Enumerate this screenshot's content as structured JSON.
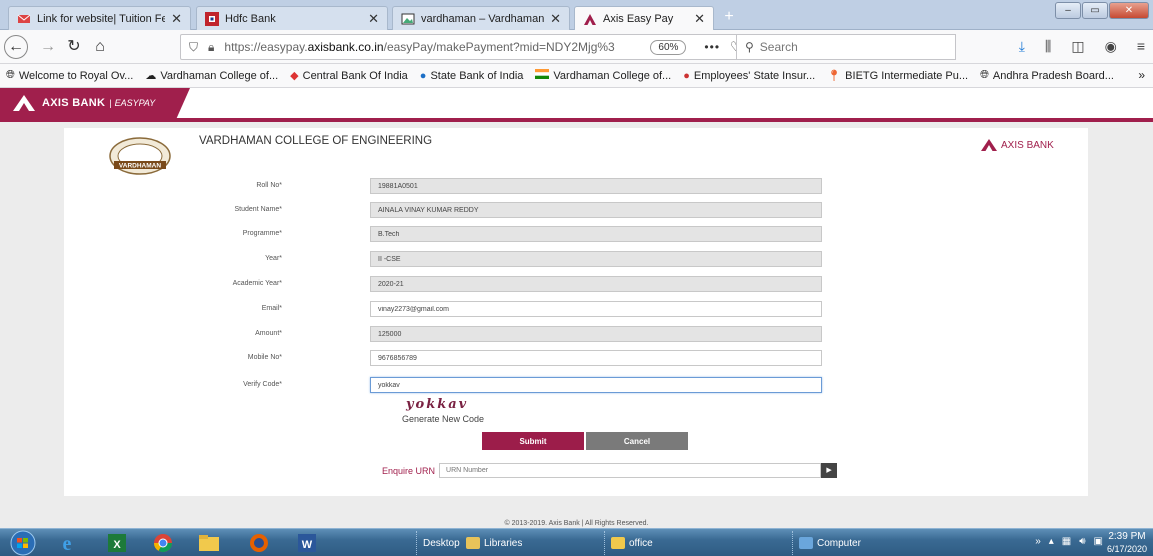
{
  "browser": {
    "tabs": [
      {
        "label": "Link for website| Tuition Fee - V",
        "icon": "mail-icon",
        "active": false
      },
      {
        "label": "Hdfc Bank",
        "icon": "hdfc-icon",
        "active": false
      },
      {
        "label": "vardhaman – Vardhaman Colle",
        "icon": "picture-icon",
        "active": false
      },
      {
        "label": "Axis Easy Pay",
        "icon": "axis-icon",
        "active": true
      }
    ],
    "url": {
      "prefix": "https://easypay.",
      "domain": "axisbank.co.in",
      "path": "/easyPay/makePayment?mid=NDY2Mjg%3"
    },
    "zoom": "60%",
    "search_placeholder": "Search",
    "bookmarks": [
      {
        "label": "Welcome to Royal Ov...",
        "icon": "globe-icon"
      },
      {
        "label": "Vardhaman College of...",
        "icon": "cloud-icon"
      },
      {
        "label": "Central Bank Of India",
        "icon": "diamond-icon"
      },
      {
        "label": "State Bank of India",
        "icon": "sbi-icon"
      },
      {
        "label": "Vardhaman College of...",
        "icon": "flag-icon"
      },
      {
        "label": "Employees' State Insur...",
        "icon": "esi-icon"
      },
      {
        "label": "BIETG Intermediate Pu...",
        "icon": "pin-icon"
      },
      {
        "label": "Andhra Pradesh Board...",
        "icon": "globe-icon"
      }
    ]
  },
  "header": {
    "brand": "AXIS BANK",
    "separator": "|",
    "product": "EASYPAY"
  },
  "card": {
    "college_name": "VARDHAMAN COLLEGE OF ENGINEERING",
    "seal_text": "VARDHAMAN",
    "axis_logo_text": "AXIS BANK"
  },
  "form": {
    "fields": [
      {
        "label": "Roll No*",
        "value": "19881A0501",
        "editable": false
      },
      {
        "label": "Student Name*",
        "value": "AINALA VINAY KUMAR REDDY",
        "editable": false
      },
      {
        "label": "Programme*",
        "value": "B.Tech",
        "editable": false
      },
      {
        "label": "Year*",
        "value": "II -CSE",
        "editable": false
      },
      {
        "label": "Academic Year*",
        "value": "2020-21",
        "editable": false
      },
      {
        "label": "Email*",
        "value": "vinay2273@gmail.com",
        "editable": true
      },
      {
        "label": "Amount*",
        "value": "125000",
        "editable": false
      },
      {
        "label": "Mobile No*",
        "value": "9676856789",
        "editable": true
      },
      {
        "label": "Verify Code*",
        "value": "yokkav",
        "editable": true
      }
    ],
    "captcha": "yokkav",
    "generate_code": "Generate New Code",
    "submit": "Submit",
    "cancel": "Cancel",
    "urn_label": "Enquire URN",
    "urn_placeholder": "URN Number"
  },
  "footer": "© 2013-2019. Axis Bank | All Rights Reserved.",
  "taskbar": {
    "groups": [
      "Desktop",
      "Libraries",
      "office",
      "Computer"
    ],
    "time": "2:39 PM",
    "date": "6/17/2020"
  },
  "colors": {
    "axis_maroon": "#a01f4c",
    "submit": "#9c1d4a",
    "cancel": "#7a7a7a"
  }
}
